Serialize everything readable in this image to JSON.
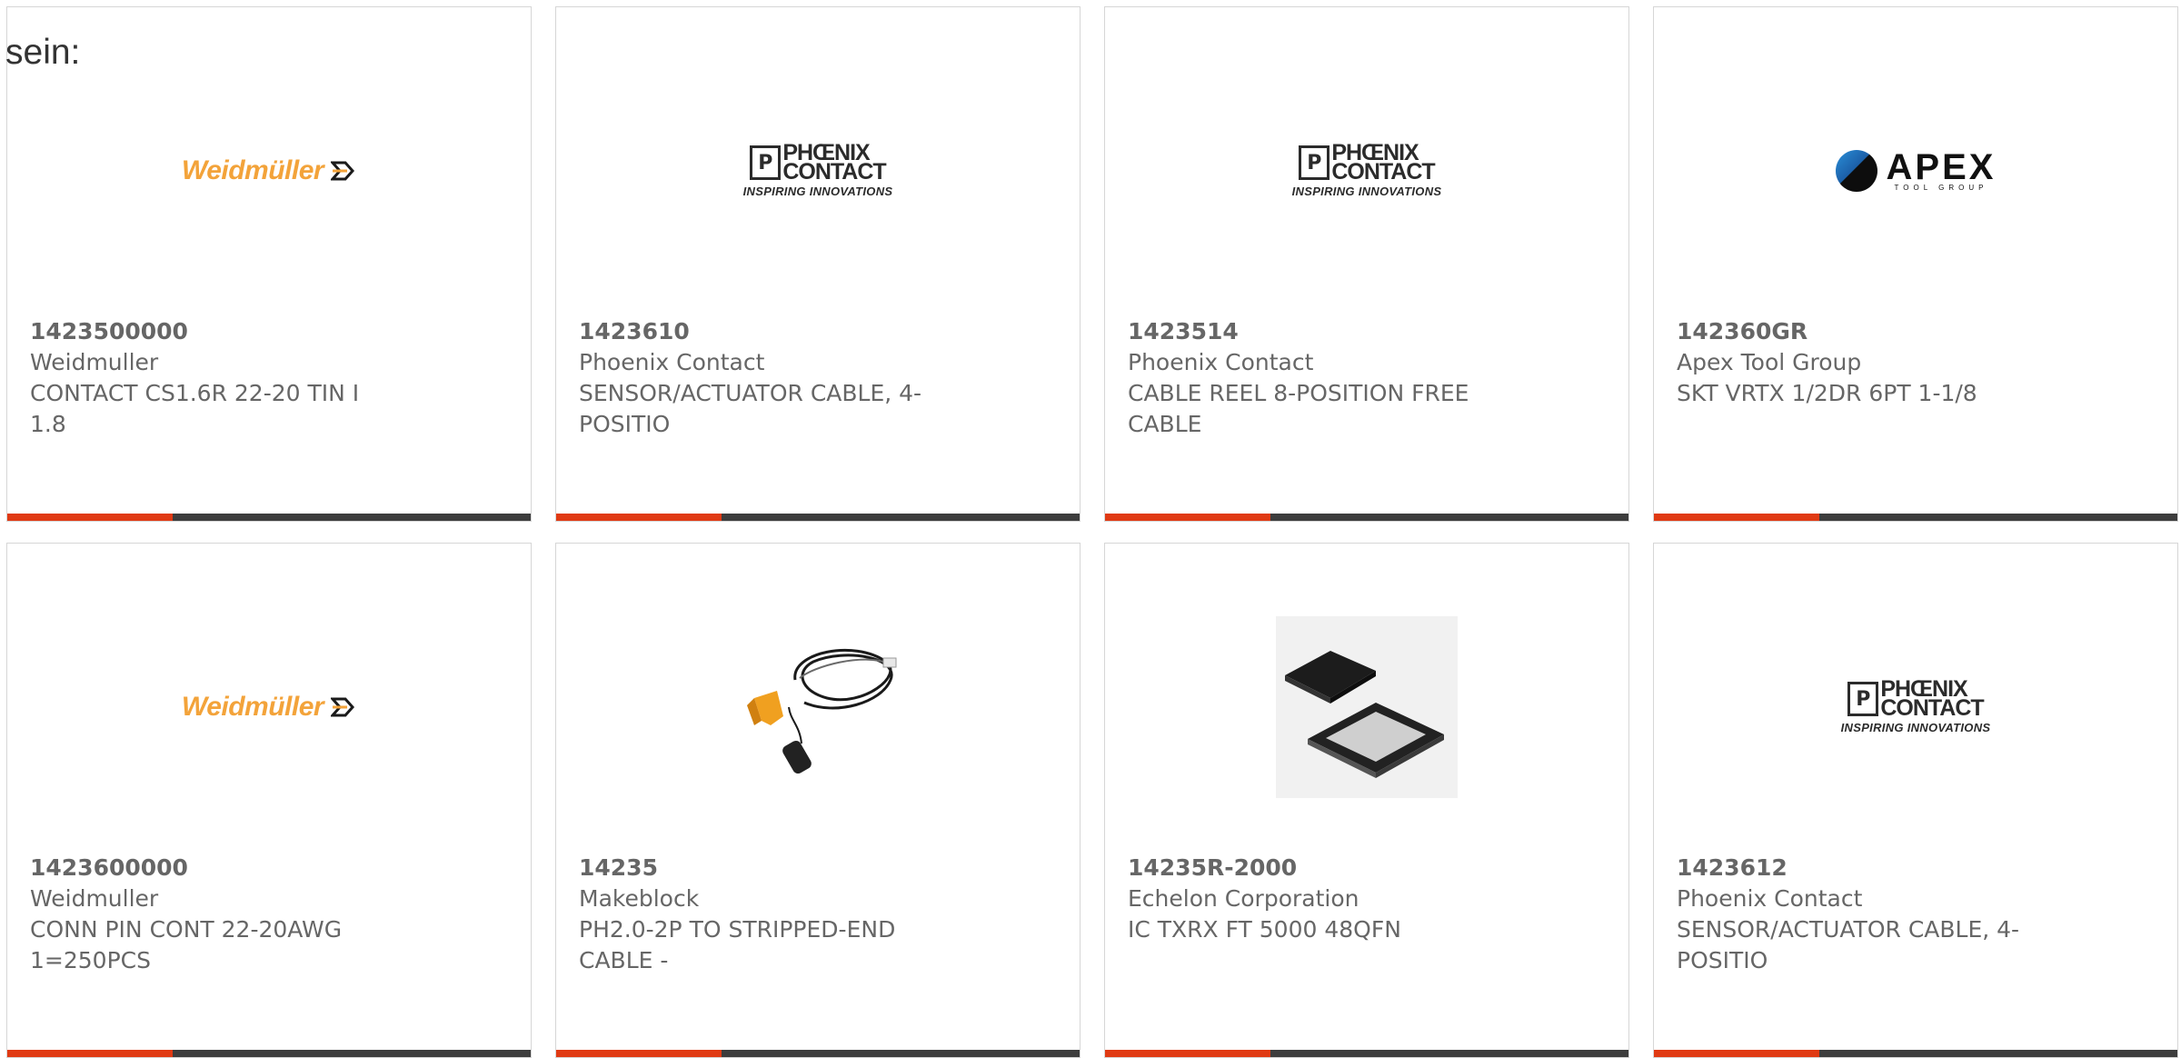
{
  "intro_text": "sein:",
  "cards": [
    {
      "part_number": "1423500000",
      "manufacturer": "Weidmuller",
      "description": "CONTACT CS1.6R 22-20 TIN I 1.8",
      "logo": "Weidmüller"
    },
    {
      "part_number": "1423610",
      "manufacturer": "Phoenix Contact",
      "description": "SENSOR/ACTUATOR CABLE, 4-POSITIO",
      "logo_top": "PHŒNIX",
      "logo_mid": "CONTACT",
      "logo_tag": "INSPIRING INNOVATIONS"
    },
    {
      "part_number": "1423514",
      "manufacturer": "Phoenix Contact",
      "description": "CABLE REEL 8-POSITION FREE CABLE",
      "logo_top": "PHŒNIX",
      "logo_mid": "CONTACT",
      "logo_tag": "INSPIRING INNOVATIONS"
    },
    {
      "part_number": "142360GR",
      "manufacturer": "Apex Tool Group",
      "description": "SKT VRTX 1/2DR 6PT 1-1/8",
      "logo_big": "APEX",
      "logo_small": "TOOL GROUP"
    },
    {
      "part_number": "1423600000",
      "manufacturer": "Weidmuller",
      "description": "CONN PIN CONT 22-20AWG 1=250PCS",
      "logo": "Weidmüller"
    },
    {
      "part_number": "14235",
      "manufacturer": "Makeblock",
      "description": "PH2.0-2P TO STRIPPED-END CABLE -"
    },
    {
      "part_number": "14235R-2000",
      "manufacturer": "Echelon Corporation",
      "description": "IC TXRX FT 5000 48QFN"
    },
    {
      "part_number": "1423612",
      "manufacturer": "Phoenix Contact",
      "description": "SENSOR/ACTUATOR CABLE, 4-POSITIO",
      "logo_top": "PHŒNIX",
      "logo_mid": "CONTACT",
      "logo_tag": "INSPIRING INNOVATIONS"
    }
  ],
  "colors": {
    "accent": "#e03a13",
    "bar": "#3d3d3d",
    "text": "#666666",
    "weidmuller_orange": "#f3a33a"
  },
  "icons": [
    "weidmuller-logo",
    "phoenix-contact-logo",
    "apex-tool-group-logo",
    "cable-product-image",
    "qfn-chip-image"
  ]
}
